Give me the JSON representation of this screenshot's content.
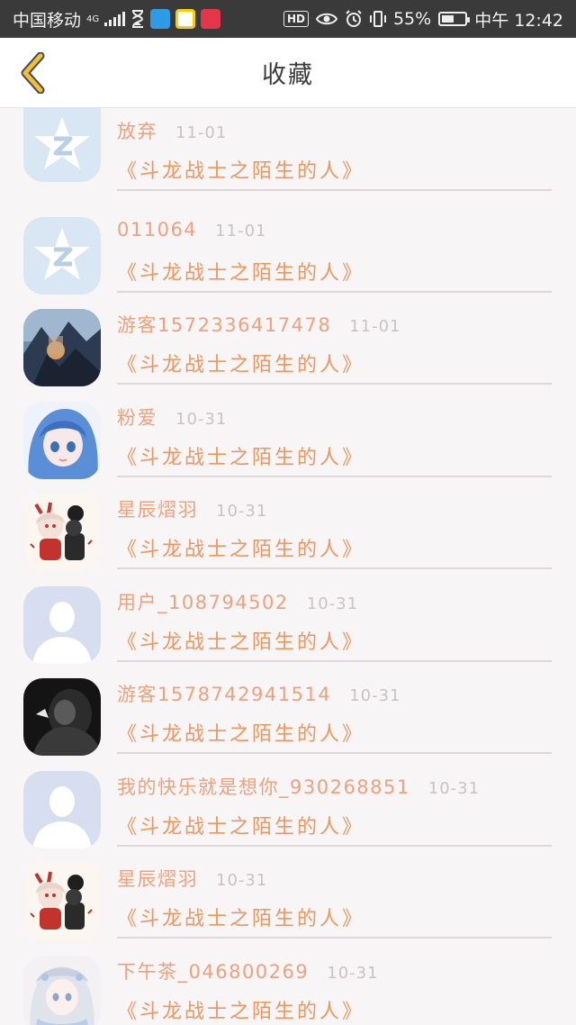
{
  "status_bar": {
    "carrier": "中国移动",
    "network": "4G",
    "app_icons": [
      "hourglass-icon",
      "delivery-app-icon",
      "face-app-icon",
      "red-app-icon"
    ],
    "hd": "HD",
    "battery": "55%",
    "battery_level": 0.55,
    "time": "中午 12:42"
  },
  "header": {
    "title": "收藏",
    "back_icon": "chevron-left-icon",
    "accent_color": "#f0c03a"
  },
  "favorites": [
    {
      "name": "放弃",
      "time": "11-01",
      "book": "《斗龙战士之陌生的人》",
      "avatar": "default-qq-star"
    },
    {
      "name": "011064",
      "time": "11-01",
      "book": "《斗龙战士之陌生的人》",
      "avatar": "default-qq-star"
    },
    {
      "name": "游客1572336417478",
      "time": "11-01",
      "book": "《斗龙战士之陌生的人》",
      "avatar": "landscape"
    },
    {
      "name": "粉爱",
      "time": "10-31",
      "book": "《斗龙战士之陌生的人》",
      "avatar": "anime-blue-hair"
    },
    {
      "name": "星辰熠羽",
      "time": "10-31",
      "book": "《斗龙战士之陌生的人》",
      "avatar": "anime-chibi"
    },
    {
      "name": "用户_108794502",
      "time": "10-31",
      "book": "《斗龙战士之陌生的人》",
      "avatar": "default-person"
    },
    {
      "name": "游客1578742941514",
      "time": "10-31",
      "book": "《斗龙战士之陌生的人》",
      "avatar": "dark-photo"
    },
    {
      "name": "我的快乐就是想你_930268851",
      "time": "10-31",
      "book": "《斗龙战士之陌生的人》",
      "avatar": "default-person"
    },
    {
      "name": "星辰熠羽",
      "time": "10-31",
      "book": "《斗龙战士之陌生的人》",
      "avatar": "anime-chibi"
    },
    {
      "name": "下午茶_046800269",
      "time": "10-31",
      "book": "《斗龙战士之陌生的人》",
      "avatar": "anime-white-hair"
    }
  ],
  "colors": {
    "name": "#f0a07c",
    "book": "#f0955e",
    "time": "#c7c3c4",
    "background": "#f7f5f6"
  }
}
